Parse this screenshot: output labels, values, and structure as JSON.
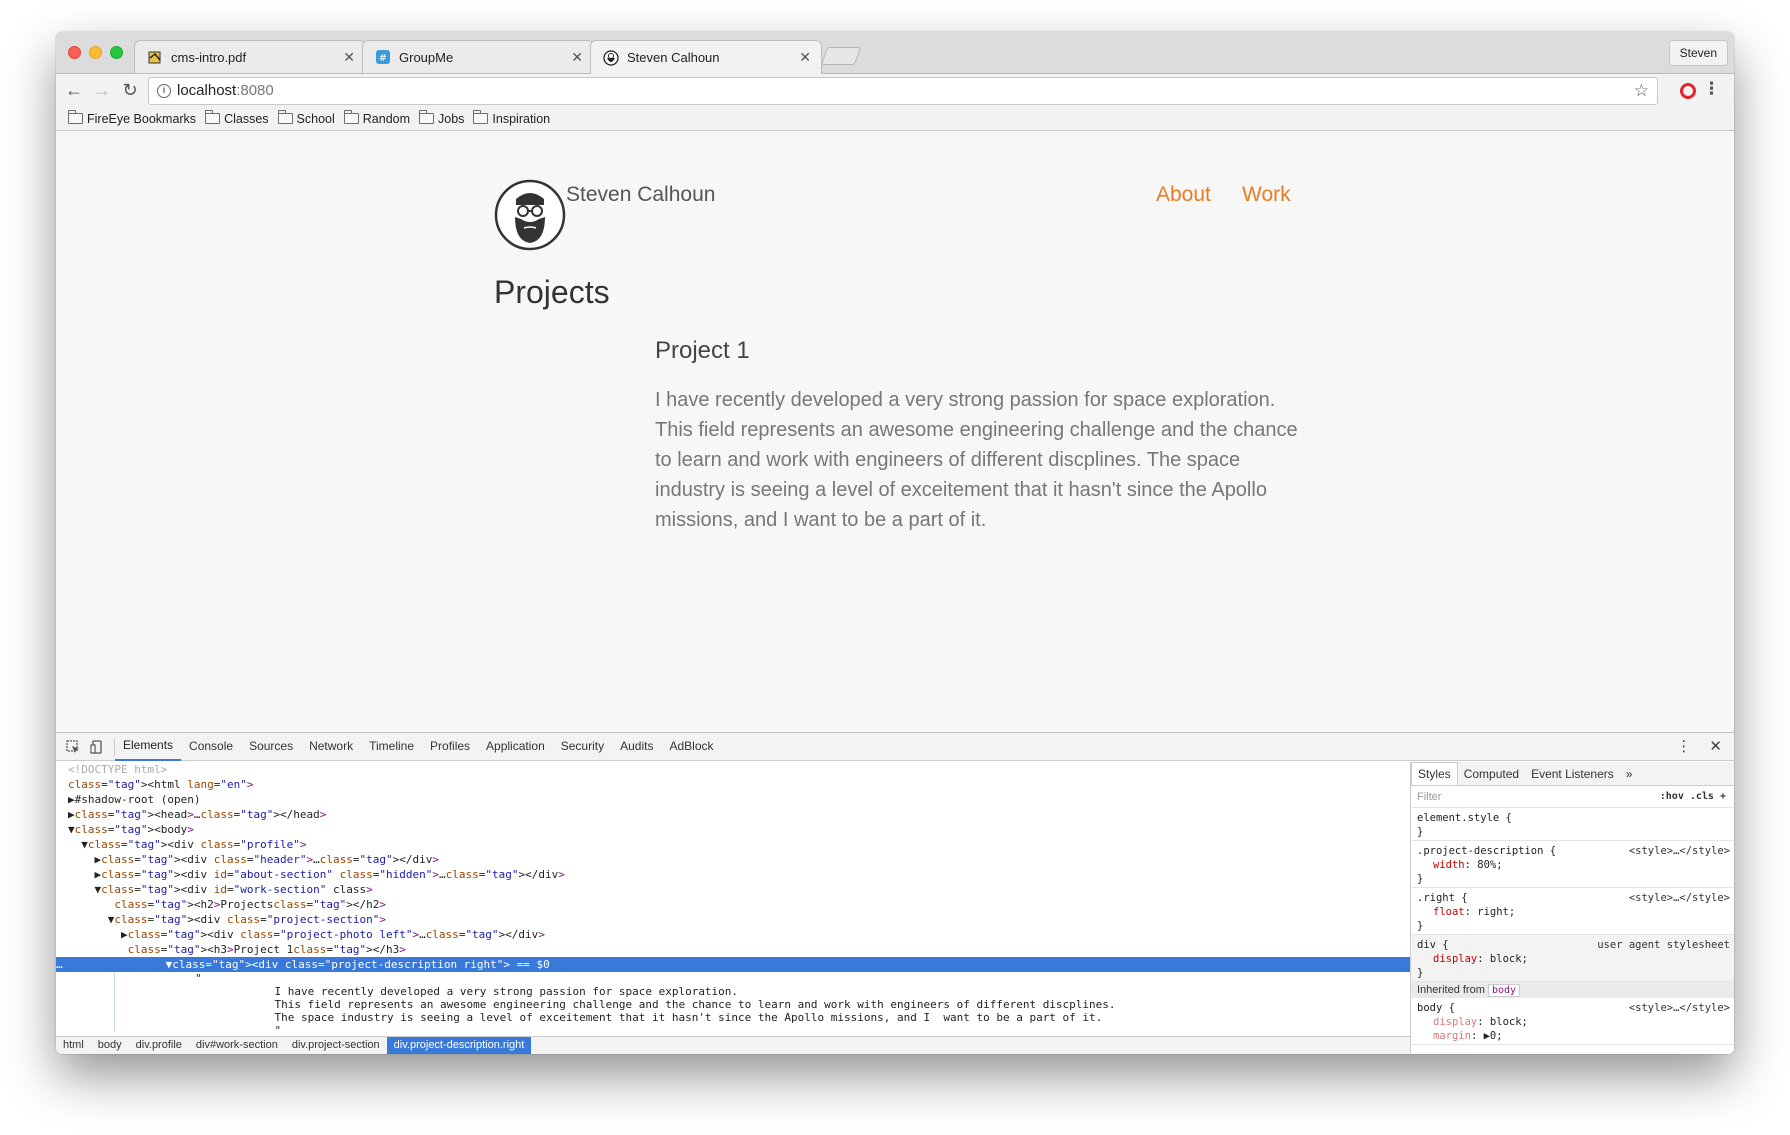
{
  "browser": {
    "tabs": [
      {
        "title": "cms-intro.pdf",
        "icon": "pdf-icon"
      },
      {
        "title": "GroupMe",
        "icon": "groupme-icon"
      },
      {
        "title": "Steven Calhoun",
        "icon": "avatar-icon"
      }
    ],
    "profile": "Steven",
    "url_host": "localhost",
    "url_port": ":8080",
    "bookmarks": [
      "FireEye Bookmarks",
      "Classes",
      "School",
      "Random",
      "Jobs",
      "Inspiration"
    ]
  },
  "page": {
    "brand": "Steven Calhoun",
    "nav": [
      "About",
      "Work"
    ],
    "section_title": "Projects",
    "project_title": "Project 1",
    "project_description": "I have recently developed a very strong passion for space exploration. This field represents an awesome engineering challenge and the chance to learn and work with engineers of different discplines. The space industry is seeing a level of exceitement that it hasn't since the Apollo missions, and I want to be a part of it.",
    "accent_color": "#e97b20"
  },
  "devtools": {
    "tabs": [
      "Elements",
      "Console",
      "Sources",
      "Network",
      "Timeline",
      "Profiles",
      "Application",
      "Security",
      "Audits",
      "AdBlock"
    ],
    "dom_lines": [
      "<!DOCTYPE html>",
      "<html lang=\"en\">",
      "▶#shadow-root (open)",
      "▶<head>…</head>",
      "▼<body>",
      "  ▼<div class=\"profile\">",
      "    ▶<div class=\"header\">…</div>",
      "    ▶<div id=\"about-section\" class=\"hidden\">…</div>",
      "    ▼<div id=\"work-section\" class>",
      "       <h2>Projects</h2>",
      "      ▼<div class=\"project-section\">",
      "        ▶<div class=\"project-photo left\">…</div>",
      "         <h3>Project 1</h3>",
      "        ▼<div class=\"project-description right\"> == $0"
    ],
    "text_node_lines": [
      "\"",
      "            I have recently developed a very strong passion for space exploration.",
      "            This field represents an awesome engineering challenge and the chance to learn and work with engineers of different discplines.",
      "            The space industry is seeing a level of exceitement that it hasn't since the Apollo missions, and I  want to be a part of it.",
      "            \""
    ],
    "breadcrumbs": [
      "html",
      "body",
      "div.profile",
      "div#work-section",
      "div.project-section",
      "div.project-description.right"
    ],
    "styles": {
      "tabs": [
        "Styles",
        "Computed",
        "Event Listeners"
      ],
      "filter_placeholder": "Filter",
      "filter_tools": ":hov  .cls  +",
      "rules": [
        {
          "selector": "element.style {",
          "source": "",
          "props": [],
          "close": "}"
        },
        {
          "selector": ".project-description {",
          "source": "<style>…</style>",
          "props": [
            {
              "name": "width",
              "value": "80%;"
            }
          ],
          "close": "}"
        },
        {
          "selector": ".right {",
          "source": "<style>…</style>",
          "props": [
            {
              "name": "float",
              "value": "right;"
            }
          ],
          "close": "}"
        },
        {
          "selector": "div {",
          "source": "user agent stylesheet",
          "props": [
            {
              "name": "display",
              "value": "block;"
            }
          ],
          "close": "}"
        }
      ],
      "inherited_label": "Inherited from",
      "inherited_from": "body",
      "body_rule": {
        "selector": "body {",
        "source": "<style>…</style>",
        "props": [
          {
            "name": "display",
            "value": "block;"
          },
          {
            "name": "margin",
            "value": "▶0;"
          }
        ]
      }
    }
  }
}
